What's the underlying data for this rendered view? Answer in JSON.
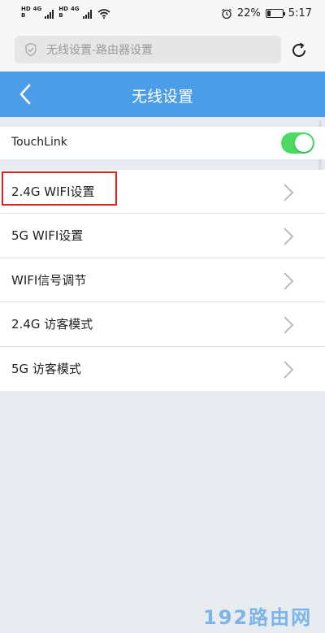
{
  "status_bar": {
    "sim1": [
      "HD",
      "B"
    ],
    "sim2": [
      "HD",
      "B"
    ],
    "net1": "4G",
    "net2": "4G",
    "battery": "22%",
    "battery_level": 0.22,
    "time": "5:17"
  },
  "browser": {
    "url_text": "无线设置-路由器设置"
  },
  "header": {
    "title": "无线设置"
  },
  "touchlink": {
    "label": "TouchLink",
    "enabled": true
  },
  "menu": {
    "items": [
      {
        "label": "2.4G WIFI设置"
      },
      {
        "label": "5G WIFI设置"
      },
      {
        "label": "WIFI信号调节"
      },
      {
        "label": "2.4G 访客模式"
      },
      {
        "label": "5G 访客模式"
      }
    ]
  },
  "watermark": "192路由网",
  "colors": {
    "header_bg": "#4a9de6",
    "toggle_on": "#4cd964",
    "highlight": "#e02020"
  }
}
